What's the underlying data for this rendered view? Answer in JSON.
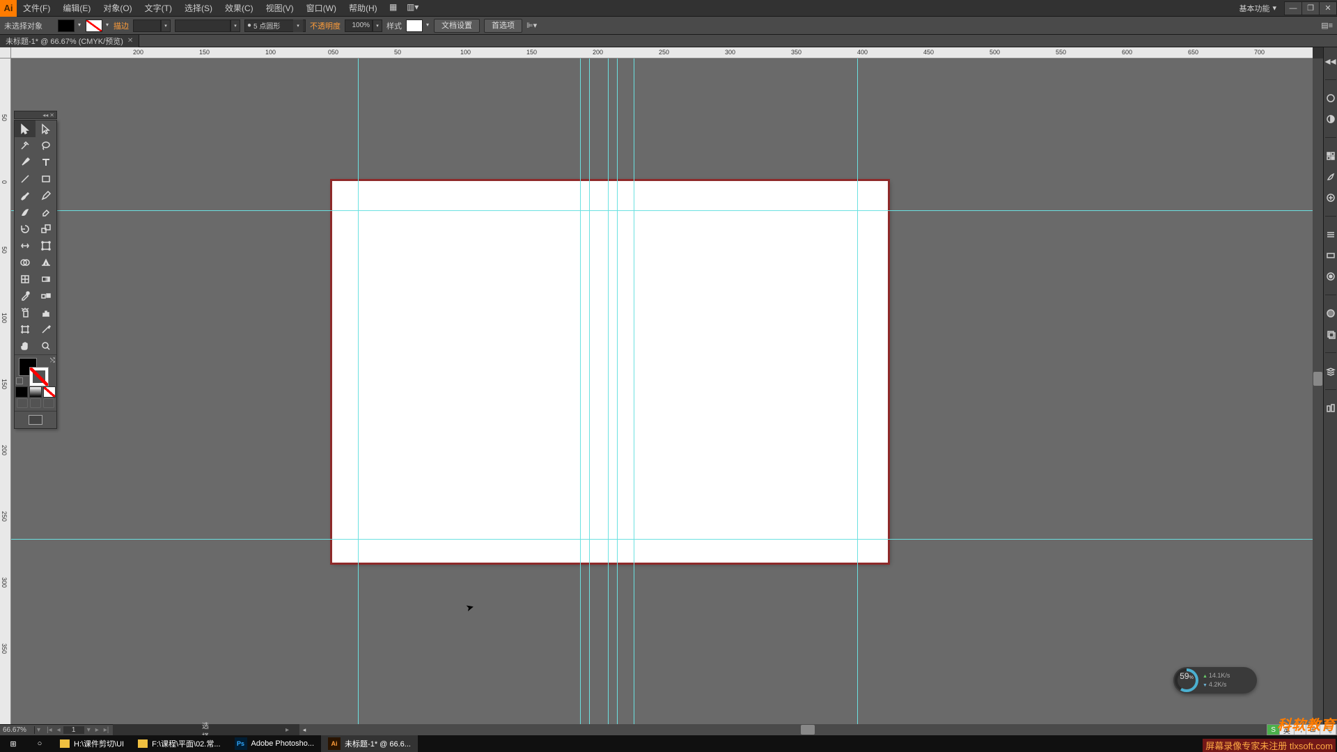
{
  "app": {
    "icon_label": "Ai"
  },
  "menu": {
    "file": "文件(F)",
    "edit": "编辑(E)",
    "object": "对象(O)",
    "type": "文字(T)",
    "select": "选择(S)",
    "effect": "效果(C)",
    "view": "视图(V)",
    "window": "窗口(W)",
    "help": "帮助(H)"
  },
  "workspace": {
    "label": "基本功能"
  },
  "control": {
    "no_selection": "未选择对象",
    "stroke_label": "描边",
    "stroke_weight": "",
    "brush_def": "5 点圆形",
    "opacity_label": "不透明度",
    "opacity_value": "100%",
    "style_label": "样式",
    "doc_setup": "文档设置",
    "preferences": "首选项",
    "align_icon": "⊫▾"
  },
  "document": {
    "tab_title": "未标题-1* @ 66.67% (CMYK/预览)"
  },
  "ruler_h": [
    "200",
    "150",
    "100",
    "50",
    "0",
    "50",
    "100",
    "150",
    "200",
    "250",
    "300",
    "350",
    "400",
    "450",
    "500",
    "550",
    "600",
    "650",
    "700"
  ],
  "ruler_v": [
    "50",
    "0",
    "50",
    "100",
    "150",
    "200",
    "250",
    "300",
    "350"
  ],
  "status": {
    "zoom": "66.67%",
    "page": "1",
    "tool": "选择"
  },
  "perf": {
    "pct": "59",
    "pct_unit": "%",
    "up": "14.1K/s",
    "down": "4.2K/s"
  },
  "taskbar": {
    "items": [
      {
        "icon": "📁",
        "label": "H:\\课件剪切\\UI"
      },
      {
        "icon": "📁",
        "label": "F:\\课程\\平面\\02.常..."
      },
      {
        "icon": "Ps",
        "label": "Adobe Photosho..."
      },
      {
        "icon": "Ai",
        "label": "未标题-1* @ 66.6..."
      }
    ]
  },
  "ime": {
    "lang": "英",
    "punct": "•,",
    "full": "⊞",
    "tool": "🔧"
  },
  "watermark": {
    "brand": "科软教育",
    "note": "屏幕录像专家未注册 tlxsoft.com"
  }
}
